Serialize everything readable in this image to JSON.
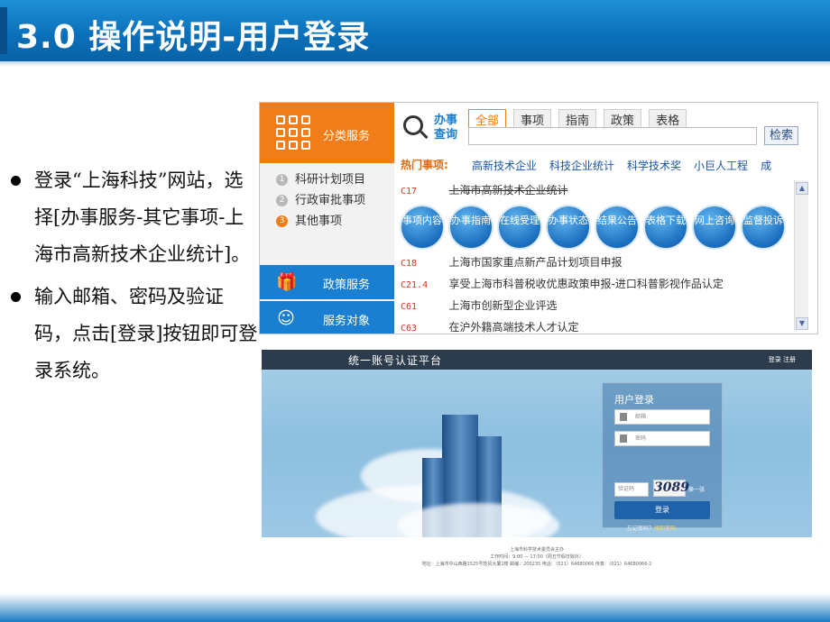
{
  "slide": {
    "title": "3.0 操作说明-用户登录",
    "bullets": [
      "登录“上海科技”网站，选择[办事服务-其它事项-上海市高新技术企业统计]。",
      "输入邮箱、密码及验证码，点击[登录]按钮即可登录系统。"
    ]
  },
  "portal": {
    "category_label": "分类服务",
    "nav_items": [
      {
        "num": "1",
        "label": "科研计划项目"
      },
      {
        "num": "2",
        "label": "行政审批事项"
      },
      {
        "num": "3",
        "label": "其他事项"
      }
    ],
    "policy_label": "政策服务",
    "target_label": "服务对象",
    "search_title": "办事查询",
    "tabs": [
      "全部",
      "事项",
      "指南",
      "政策",
      "表格"
    ],
    "search_button": "检索",
    "hot_label": "热门事项:",
    "hot_links": [
      "高新技术企业",
      "科技企业统计",
      "科学技术奖",
      "小巨人工程",
      "成"
    ],
    "rows": [
      {
        "code": "C17",
        "text": "上海市高新技术企业统计"
      },
      {
        "code": "C18",
        "text": "上海市国家重点新产品计划项目申报"
      },
      {
        "code": "C21.4",
        "text": "享受上海市科普税收优惠政策申报-进口科普影视作品认定"
      },
      {
        "code": "C61",
        "text": "上海市创新型企业评选"
      },
      {
        "code": "C63",
        "text": "在沪外籍高端技术人才认定"
      }
    ],
    "circles": [
      "事项内容",
      "办事指南",
      "在线受理",
      "办事状态",
      "结果公告",
      "表格下载",
      "网上咨询",
      "监督投诉"
    ]
  },
  "login_site": {
    "brand": "统一账号认证平台",
    "top_links": "登录 注册",
    "panel_title": "用户登录",
    "email_placeholder": "邮箱",
    "password_placeholder": "密码",
    "captcha_placeholder": "验证码",
    "captcha_value": "3089",
    "captcha_refresh": "换一张",
    "login_button": "登录",
    "forget_text": "忘记密码？",
    "forget_link": "找回密码",
    "footer": [
      "上海市科学技术委员会主办",
      "工作时间：9:00 — 17:00（周五节假日除外）",
      "地址：上海市中山西路1525号技贸大厦2楼  邮编：200235  电话：（021）64680066  传真：（021）64680066-2"
    ]
  },
  "colors": {
    "title_bg": "#0a6fb8",
    "orange": "#f07d1a",
    "blue": "#1a7fd0"
  }
}
